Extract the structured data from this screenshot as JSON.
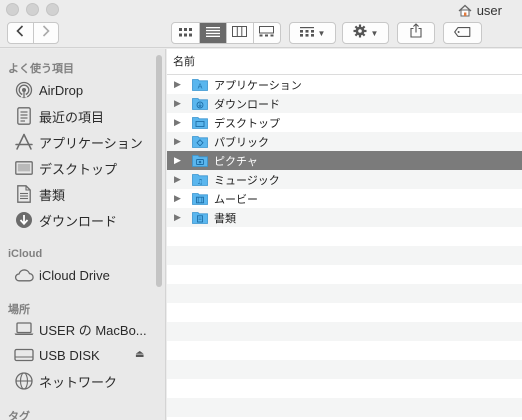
{
  "window": {
    "title": "user",
    "traffic_light_color": "#d1d1d1"
  },
  "toolbar": {
    "back_icon": "chevron-left-icon",
    "forward_icon": "chevron-right-icon",
    "views": [
      {
        "name": "icon-view-icon",
        "active": false
      },
      {
        "name": "list-view-icon",
        "active": true
      },
      {
        "name": "column-view-icon",
        "active": false
      },
      {
        "name": "gallery-view-icon",
        "active": false
      }
    ],
    "active_color": "#6a6a6a"
  },
  "sidebar": {
    "sections": {
      "favorites": "よく使う項目",
      "icloud": "iCloud",
      "locations": "場所",
      "tags": "タグ"
    },
    "favorites": [
      {
        "label": "AirDrop",
        "icon": "airdrop-icon"
      },
      {
        "label": "最近の項目",
        "icon": "recents-icon"
      },
      {
        "label": "アプリケーション",
        "icon": "applications-icon"
      },
      {
        "label": "デスクトップ",
        "icon": "desktop-icon"
      },
      {
        "label": "書類",
        "icon": "documents-icon"
      },
      {
        "label": "ダウンロード",
        "icon": "downloads-icon"
      }
    ],
    "icloud": [
      {
        "label": "iCloud Drive",
        "icon": "icloud-icon"
      }
    ],
    "locations": [
      {
        "label": "USER の MacBo...",
        "icon": "laptop-icon"
      },
      {
        "label": "USB DISK",
        "icon": "drive-icon"
      },
      {
        "label": "ネットワーク",
        "icon": "network-icon"
      }
    ]
  },
  "list": {
    "column_name": "名前",
    "folder_color": "#5ab6ee",
    "selected_color": "#7b7b7b",
    "items": [
      {
        "name": "アプリケーション",
        "glyph": "A"
      },
      {
        "name": "ダウンロード",
        "glyph": "↓"
      },
      {
        "name": "デスクトップ",
        "glyph": ""
      },
      {
        "name": "パブリック",
        "glyph": "◆"
      },
      {
        "name": "ピクチャ",
        "glyph": "▣",
        "selected": true
      },
      {
        "name": "ミュージック",
        "glyph": "♫"
      },
      {
        "name": "ムービー",
        "glyph": "▦"
      },
      {
        "name": "書類",
        "glyph": "▤"
      }
    ]
  }
}
